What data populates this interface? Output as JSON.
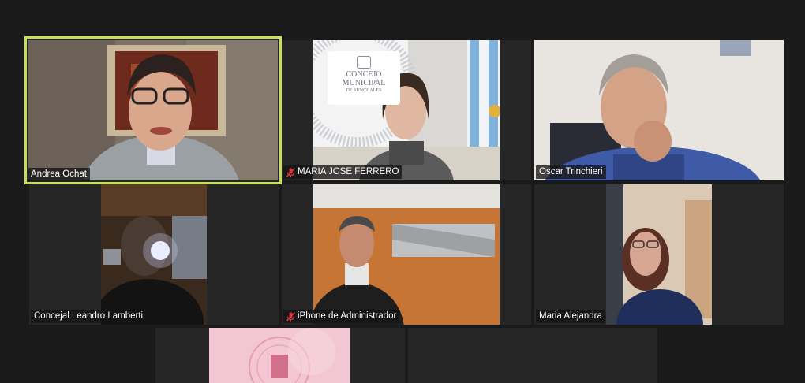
{
  "participants": [
    {
      "name": "Andrea Ochat",
      "muted": false,
      "active": true
    },
    {
      "name": "MARIA JOSE FERRERO",
      "muted": true,
      "active": false
    },
    {
      "name": "Oscar Trinchieri",
      "muted": false,
      "active": false
    },
    {
      "name": "Concejal Leandro Lamberti",
      "muted": false,
      "active": false
    },
    {
      "name": "iPhone de Administrador",
      "muted": true,
      "active": false
    },
    {
      "name": "Maria Alejandra",
      "muted": false,
      "active": false
    }
  ],
  "banner": {
    "logo_line1": "CONCEJO",
    "logo_line2": "MUNICIPAL",
    "logo_line3": "DE SUNCHALES"
  },
  "colors": {
    "active_border": "#c6de5a",
    "muted_icon": "#e0363f",
    "tile_bg": "#262626",
    "page_bg": "#1a1a1a"
  }
}
